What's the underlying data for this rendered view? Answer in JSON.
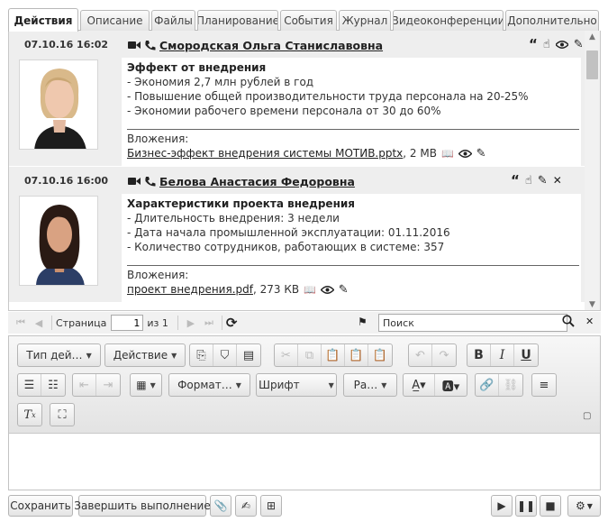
{
  "tabs": [
    {
      "label": "Действия",
      "active": true
    },
    {
      "label": "Описание"
    },
    {
      "label": "Файлы"
    },
    {
      "label": "Планирование"
    },
    {
      "label": "События"
    },
    {
      "label": "Журнал"
    },
    {
      "label": "Видеоконференции"
    },
    {
      "label": "Дополнительно"
    }
  ],
  "entries": [
    {
      "date": "07.10.16 16:02",
      "author": "Смородская Ольга Станиславовна",
      "title": "Эффект от внедрения",
      "lines": [
        "- Экономия 2,7 млн рублей в год",
        "- Повышение общей производительности труда персонала на 20-25%",
        "- Экономии рабочего времени персонала от 30 до 60%"
      ],
      "attachments_label": "Вложения:",
      "file_name": "Бизнес-эффект внедрения системы МОТИВ.pptx",
      "file_size": ", 2 МВ"
    },
    {
      "date": "07.10.16 16:00",
      "author": "Белова Анастасия Федоровна",
      "title": "Характеристики проекта внедрения",
      "lines": [
        "- Длительность внедрения: 3 недели",
        "- Дата начала промышленной эксплуатации: 01.11.2016",
        "- Количество сотрудников, работающих в системе: 357"
      ],
      "attachments_label": "Вложения:",
      "file_name": "проект внедрения.pdf",
      "file_size": ", 273 КВ"
    }
  ],
  "pager": {
    "page_label": "Страница",
    "page_value": "1",
    "of_label": "из 1",
    "search_value": "Поиск"
  },
  "toolbar": {
    "action_type": "Тип дей…",
    "action": "Действие",
    "format": "Формат…",
    "font": "Шрифт",
    "size": "Ра…"
  },
  "footer": {
    "save": "Сохранить",
    "finish": "Завершить выполнение"
  },
  "colors": {
    "tab_bg": "#e5e5e5",
    "entry_bg": "#eeeeee",
    "toolbar_bg": "#e3e3e3"
  },
  "icons": [
    "video-icon",
    "phone-icon",
    "quote-icon",
    "hand-icon",
    "eye-icon",
    "pencil-icon",
    "close-icon",
    "refresh-icon",
    "flag-icon",
    "search-icon"
  ]
}
